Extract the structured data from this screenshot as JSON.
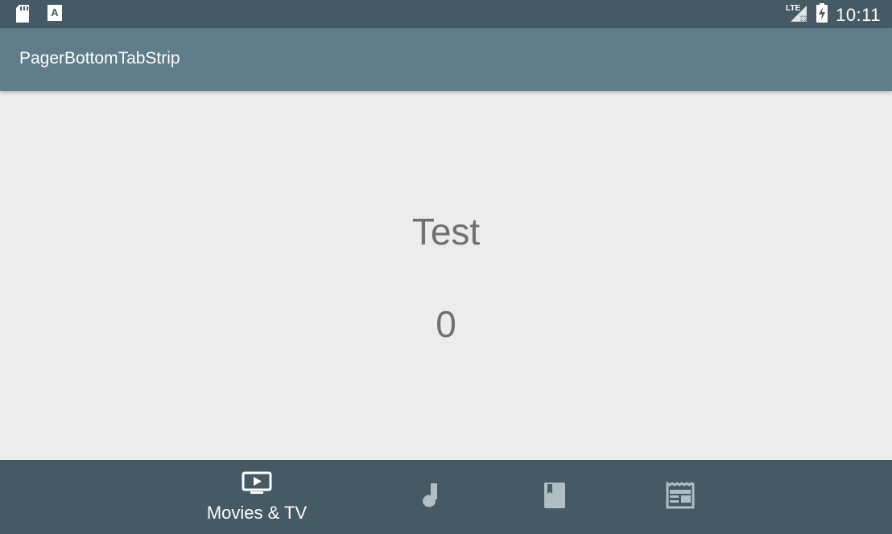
{
  "status_bar": {
    "left_icons": [
      "sd-card-icon",
      "text-a-icon"
    ],
    "network": "LTE",
    "time": "10:11"
  },
  "app_bar": {
    "title": "PagerBottomTabStrip"
  },
  "content": {
    "title": "Test",
    "count": "0"
  },
  "bottom_tabs": [
    {
      "icon": "tv-play-icon",
      "label": "Movies & TV",
      "selected": true
    },
    {
      "icon": "music-note-icon",
      "label": "",
      "selected": false
    },
    {
      "icon": "book-icon",
      "label": "",
      "selected": false
    },
    {
      "icon": "newspaper-icon",
      "label": "",
      "selected": false
    }
  ],
  "colors": {
    "status_bar": "#455a64",
    "app_bar": "#607d8b",
    "bottom_bar": "#455a64",
    "background": "#ececec",
    "text": "#707070",
    "inactive_icon": "#b0bec5"
  }
}
